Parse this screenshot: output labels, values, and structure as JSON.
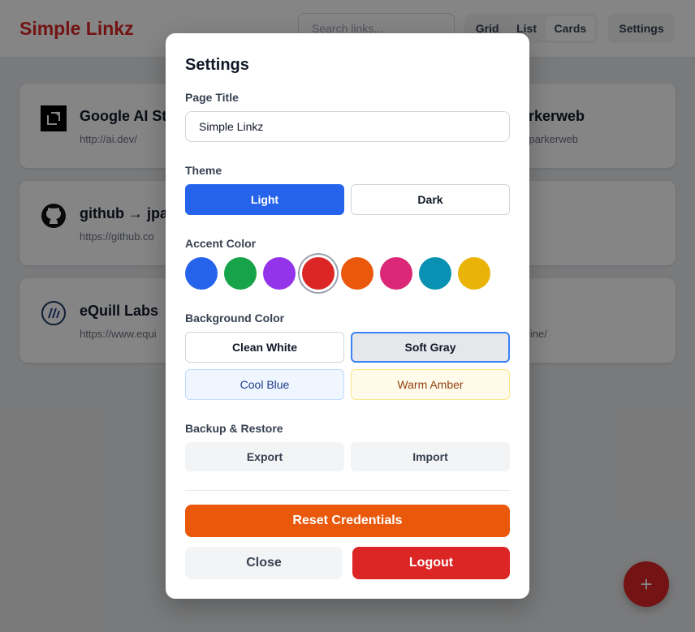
{
  "header": {
    "brand": "Simple Linkz",
    "search_placeholder": "Search links...",
    "views": [
      "Grid",
      "List",
      "Cards"
    ],
    "active_view": "Cards",
    "settings_label": "Settings"
  },
  "links": [
    {
      "title": "Google AI Stu",
      "url": "http://ai.dev/",
      "icon": "google-ai-studio-icon"
    },
    {
      "title": "→ jparkerweb",
      "url": "/u/jparkerweb",
      "icon": ""
    },
    {
      "title": "github → jpar",
      "url": "https://github.co",
      "icon": "github-icon"
    },
    {
      "title": "eQuill Labs",
      "url": "https://www.equi",
      "icon": "equill-labs-icon"
    },
    {
      "title": "",
      "url": "line/",
      "icon": ""
    }
  ],
  "fab_label": "+",
  "settings_modal": {
    "title": "Settings",
    "page_title": {
      "label": "Page Title",
      "value": "Simple Linkz"
    },
    "theme": {
      "label": "Theme",
      "options": [
        "Light",
        "Dark"
      ],
      "selected": "Light"
    },
    "accent": {
      "label": "Accent Color",
      "colors": [
        "#2563eb",
        "#16a34a",
        "#9333ea",
        "#dc2626",
        "#ea580c",
        "#db2777",
        "#0891b2",
        "#eab308"
      ],
      "selected": "#dc2626"
    },
    "background": {
      "label": "Background Color",
      "options": [
        "Clean White",
        "Soft Gray",
        "Cool Blue",
        "Warm Amber"
      ],
      "selected": "Soft Gray"
    },
    "backup": {
      "label": "Backup & Restore",
      "export_label": "Export",
      "import_label": "Import"
    },
    "reset_label": "Reset Credentials",
    "close_label": "Close",
    "logout_label": "Logout"
  }
}
